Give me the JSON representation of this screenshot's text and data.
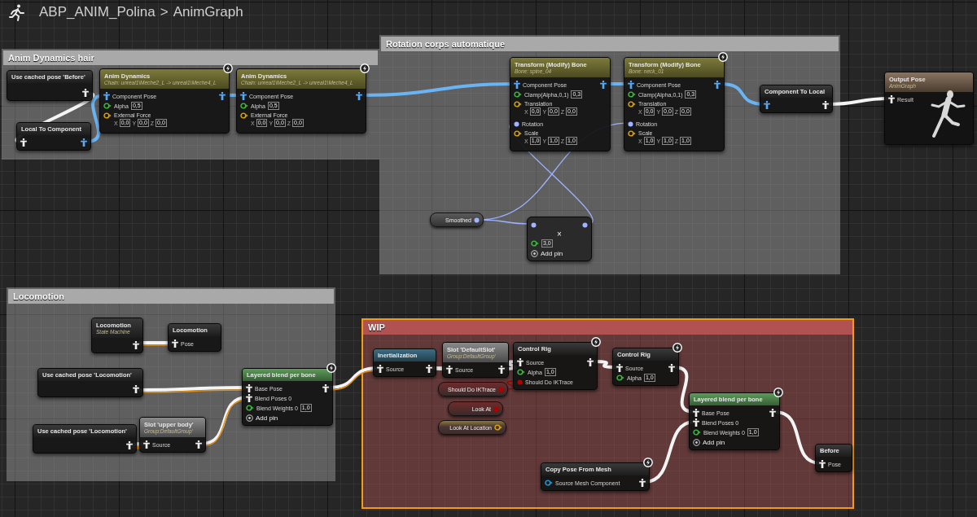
{
  "breadcrumb": {
    "items": [
      {
        "label": "ABP_ANIM_Polina"
      },
      {
        "label": "AnimGraph"
      }
    ],
    "separator": ">"
  },
  "comments": [
    {
      "title": "Anim Dynamics hair",
      "color": "#a9a9a9",
      "selected": false
    },
    {
      "title": "Rotation corps automatique",
      "color": "#a9a9a9",
      "selected": false
    },
    {
      "title": "Locomotion",
      "color": "#a9a9a9",
      "selected": false
    },
    {
      "title": "WIP",
      "color": "#b05252",
      "selected": true
    }
  ],
  "nodes": [
    {
      "kind": "plain",
      "title": "Use cached pose 'Before'",
      "fast_path": false,
      "rows": [
        {
          "kind": "none",
          "output": {
            "kind": "pose"
          }
        }
      ]
    },
    {
      "kind": "plain",
      "title": "Local To Component",
      "fast_path": false,
      "rows": [
        {
          "kind": "pose",
          "output": {
            "kind": "component_pose"
          }
        }
      ]
    },
    {
      "kind": "skeletal",
      "title": "Anim Dynamics",
      "subtitle": "Chain: unreal1\\Meche2_L -> unreal1\\Meche4_L",
      "fast_path": true,
      "rows": [
        {
          "kind": "component_pose",
          "label": "Component Pose",
          "output": {
            "kind": "component_pose"
          }
        },
        {
          "kind": "float",
          "label": "Alpha",
          "values": [
            "0,5"
          ]
        },
        {
          "kind": "vector",
          "label": "External Force",
          "axes": [
            {
              "axis": "X",
              "value": "0,0"
            },
            {
              "axis": "Y",
              "value": "0,0"
            },
            {
              "axis": "Z",
              "value": "0,0"
            }
          ]
        }
      ]
    },
    {
      "kind": "skeletal",
      "title": "Anim Dynamics",
      "subtitle": "Chain: unreal1\\Meche2_L -> unreal1\\Meche4_L",
      "fast_path": true,
      "rows": [
        {
          "kind": "component_pose",
          "label": "Component Pose",
          "output": {
            "kind": "component_pose"
          }
        },
        {
          "kind": "float",
          "label": "Alpha",
          "values": [
            "0,5"
          ]
        },
        {
          "kind": "vector",
          "label": "External Force",
          "axes": [
            {
              "axis": "X",
              "value": "0,0"
            },
            {
              "axis": "Y",
              "value": "0,0"
            },
            {
              "axis": "Z",
              "value": "0,0"
            }
          ]
        }
      ]
    },
    {
      "kind": "skeletal",
      "title": "Transform (Modify) Bone",
      "subtitle": "Bone: spine_04",
      "fast_path": false,
      "rows": [
        {
          "kind": "component_pose",
          "label": "Component Pose",
          "output": {
            "kind": "component_pose"
          }
        },
        {
          "kind": "float",
          "label": "Clamp(Alpha,0,1)",
          "values": [
            "0,3"
          ]
        },
        {
          "kind": "vector",
          "label": "Translation",
          "axes": [
            {
              "axis": "X",
              "value": "0,0"
            },
            {
              "axis": "Y",
              "value": "0,0"
            },
            {
              "axis": "Z",
              "value": "0,0"
            }
          ]
        },
        {
          "kind": "rotator",
          "label": "Rotation"
        },
        {
          "kind": "vector",
          "label": "Scale",
          "axes": [
            {
              "axis": "X",
              "value": "1,0"
            },
            {
              "axis": "Y",
              "value": "1,0"
            },
            {
              "axis": "Z",
              "value": "1,0"
            }
          ]
        }
      ]
    },
    {
      "kind": "skeletal",
      "title": "Transform (Modify) Bone",
      "subtitle": "Bone: neck_01",
      "fast_path": true,
      "rows": [
        {
          "kind": "component_pose",
          "label": "Component Pose",
          "output": {
            "kind": "component_pose"
          }
        },
        {
          "kind": "float",
          "label": "Clamp(Alpha,0,1)",
          "values": [
            "0,3"
          ]
        },
        {
          "kind": "vector",
          "label": "Translation",
          "axes": [
            {
              "axis": "X",
              "value": "0,0"
            },
            {
              "axis": "Y",
              "value": "0,0"
            },
            {
              "axis": "Z",
              "value": "0,0"
            }
          ]
        },
        {
          "kind": "rotator",
          "label": "Rotation"
        },
        {
          "kind": "vector",
          "label": "Scale",
          "axes": [
            {
              "axis": "X",
              "value": "1,0"
            },
            {
              "axis": "Y",
              "value": "1,0"
            },
            {
              "axis": "Z",
              "value": "1,0"
            }
          ]
        }
      ]
    },
    {
      "kind": "plain",
      "title": "Component To Local",
      "fast_path": false,
      "rows": [
        {
          "kind": "component_pose",
          "output": {
            "kind": "pose"
          }
        }
      ]
    },
    {
      "kind": "output",
      "title": "Output Pose",
      "subtitle": "AnimGraph",
      "fast_path": false,
      "rows": [
        {
          "kind": "pose",
          "label": "Result"
        }
      ]
    },
    {
      "kind": "getter",
      "label": "Smoothed",
      "pin": {
        "kind": "rotator"
      }
    },
    {
      "kind": "math",
      "symbol": "×",
      "rows": [
        {
          "kind": "rotator",
          "output": {
            "kind": "rotator"
          }
        },
        {
          "kind": "float",
          "values": [
            "3,0"
          ]
        },
        {
          "kind": "addpin",
          "label": "Add pin"
        }
      ]
    },
    {
      "kind": "plain",
      "title": "Locomotion",
      "subtitle": "State Machine",
      "fast_path": false,
      "rows": [
        {
          "kind": "none",
          "output": {
            "kind": "pose"
          }
        }
      ]
    },
    {
      "kind": "plain",
      "title": "Locomotion",
      "fast_path": false,
      "rows": [
        {
          "kind": "pose",
          "label": "Pose"
        }
      ]
    },
    {
      "kind": "plain",
      "title": "Use cached pose 'Locomotion'",
      "fast_path": false,
      "rows": [
        {
          "kind": "none",
          "output": {
            "kind": "pose"
          }
        }
      ]
    },
    {
      "kind": "plain",
      "title": "Use cached pose 'Locomotion'",
      "fast_path": false,
      "rows": [
        {
          "kind": "none",
          "output": {
            "kind": "pose"
          }
        }
      ]
    },
    {
      "kind": "slot",
      "title": "Slot 'upper body'",
      "subtitle": "Group:DefaultGroup'",
      "fast_path": false,
      "rows": [
        {
          "kind": "pose",
          "label": "Source",
          "output": {
            "kind": "pose"
          }
        }
      ]
    },
    {
      "kind": "blend",
      "title": "Layered blend per bone",
      "fast_path": true,
      "rows": [
        {
          "kind": "pose",
          "label": "Base Pose",
          "output": {
            "kind": "pose"
          }
        },
        {
          "kind": "pose",
          "label": "Blend Poses 0"
        },
        {
          "kind": "float",
          "label": "Blend Weights 0",
          "values": [
            "1,0"
          ]
        },
        {
          "kind": "addpin",
          "label": "Add pin"
        }
      ]
    },
    {
      "kind": "inertial",
      "title": "Inertialization",
      "fast_path": false,
      "rows": [
        {
          "kind": "pose",
          "label": "Source",
          "output": {
            "kind": "pose"
          }
        }
      ]
    },
    {
      "kind": "slot",
      "title": "Slot 'DefaultSlot'",
      "subtitle": "Group:DefaultGroup'",
      "fast_path": false,
      "rows": [
        {
          "kind": "pose",
          "label": "Source",
          "output": {
            "kind": "pose"
          }
        }
      ]
    },
    {
      "kind": "plain",
      "title": "Control Rig",
      "fast_path": true,
      "rows": [
        {
          "kind": "pose",
          "label": "Source",
          "output": {
            "kind": "pose"
          }
        },
        {
          "kind": "float",
          "label": "Alpha",
          "values": [
            "1,0"
          ]
        },
        {
          "kind": "bool",
          "label": "Should Do IKTrace"
        }
      ]
    },
    {
      "kind": "plain",
      "title": "Control Rig",
      "fast_path": true,
      "rows": [
        {
          "kind": "pose",
          "label": "Source",
          "output": {
            "kind": "pose"
          }
        },
        {
          "kind": "float",
          "label": "Alpha",
          "values": [
            "1,0"
          ]
        }
      ]
    },
    {
      "kind": "getter",
      "label": "Should Do IKTrace",
      "pin": {
        "kind": "bool"
      }
    },
    {
      "kind": "getter",
      "label": "Look At",
      "pin": {
        "kind": "bool"
      }
    },
    {
      "kind": "getter",
      "label": "Look At Location",
      "pin": {
        "kind": "vector"
      }
    },
    {
      "kind": "plain",
      "title": "Copy Pose From Mesh",
      "fast_path": true,
      "rows": [
        {
          "kind": "object",
          "label": "Source Mesh Component",
          "output": {
            "kind": "pose"
          }
        }
      ]
    },
    {
      "kind": "blend",
      "title": "Layered blend per bone",
      "fast_path": true,
      "rows": [
        {
          "kind": "pose",
          "label": "Base Pose",
          "output": {
            "kind": "pose"
          }
        },
        {
          "kind": "pose",
          "label": "Blend Poses 0"
        },
        {
          "kind": "float",
          "label": "Blend Weights 0",
          "values": [
            "1,0"
          ]
        },
        {
          "kind": "addpin",
          "label": "Add pin"
        }
      ]
    },
    {
      "kind": "plain",
      "title": "Before",
      "fast_path": false,
      "rows": [
        {
          "kind": "pose",
          "label": "Pose"
        }
      ]
    }
  ]
}
